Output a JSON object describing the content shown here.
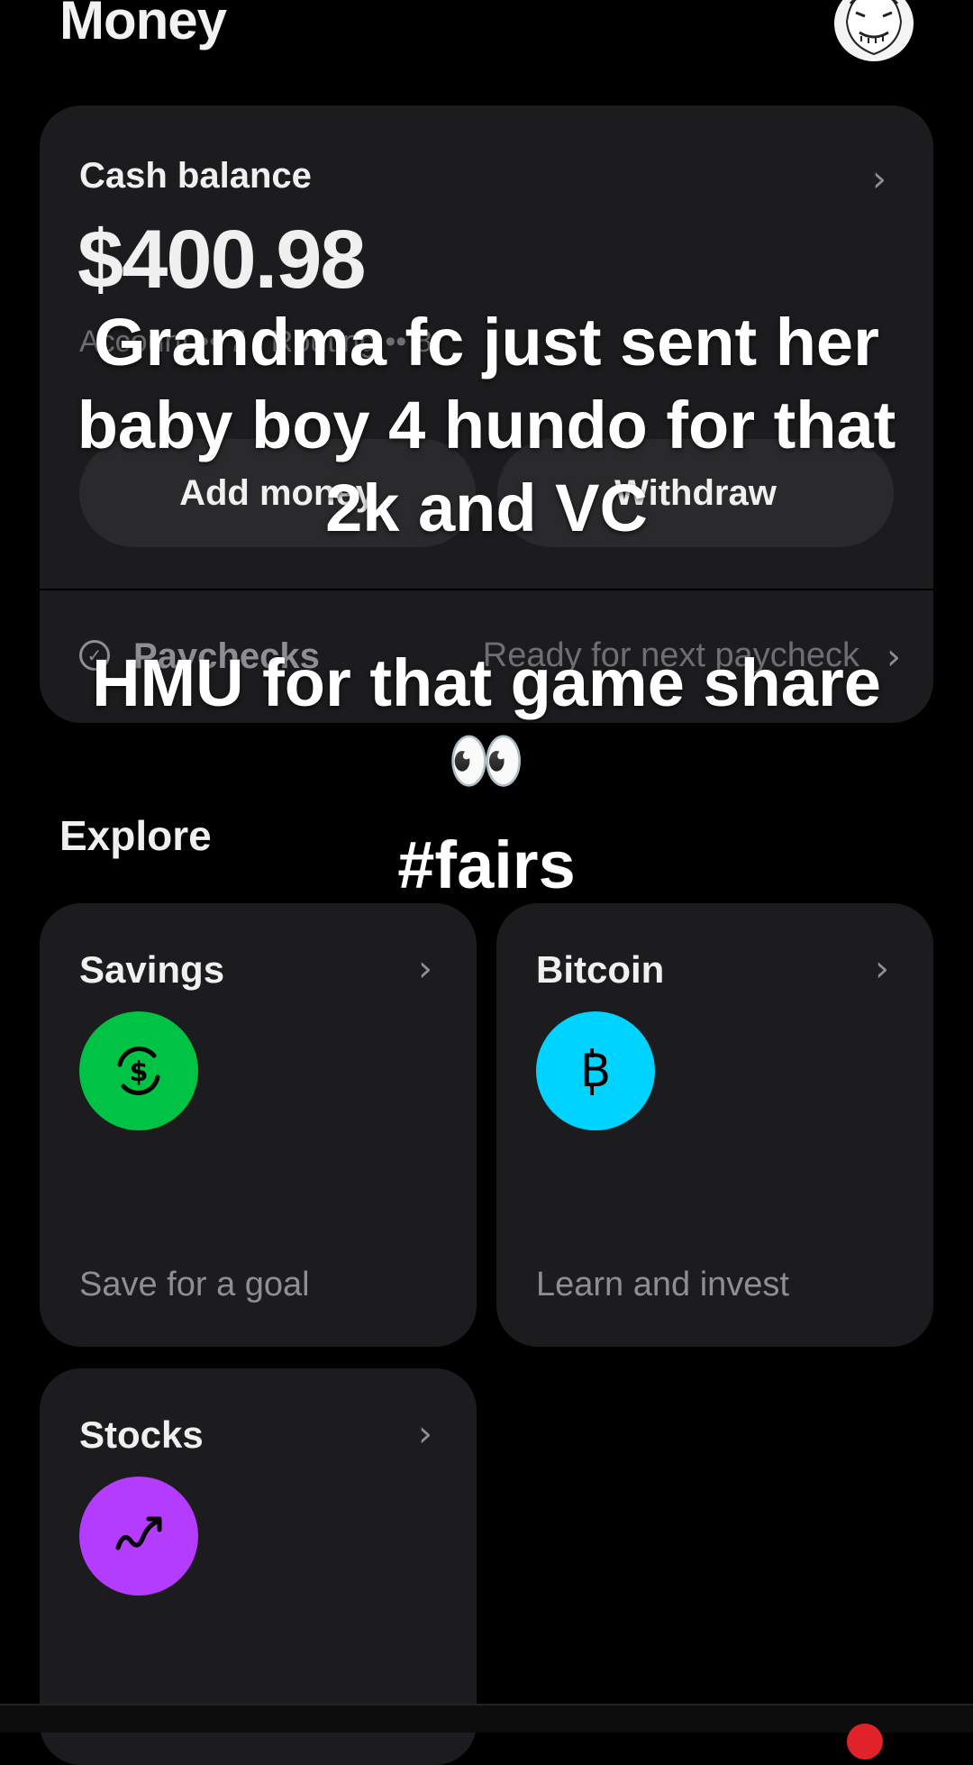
{
  "header": {
    "title": "Money"
  },
  "cash": {
    "label": "Cash balance",
    "balance": "$400.98",
    "routing": "Account •• 7 / Routing •• 8",
    "add_money": "Add money",
    "withdraw": "Withdraw"
  },
  "paychecks": {
    "label": "Paychecks",
    "status": "Ready for next paycheck"
  },
  "explore": {
    "title": "Explore",
    "tiles": [
      {
        "title": "Savings",
        "subtitle": "Save for a goal",
        "icon": "dollar-circle-icon",
        "color": "#00c244"
      },
      {
        "title": "Bitcoin",
        "subtitle": "Learn and invest",
        "icon": "bitcoin-icon",
        "color": "#00d3ff"
      },
      {
        "title": "Stocks",
        "subtitle": "",
        "icon": "stocks-trend-icon",
        "color": "#b43cff"
      }
    ]
  },
  "overlay": {
    "caption1_line1": "Grandma fc just sent her",
    "caption1_line2": "baby boy 4 hundo for that",
    "caption1_line3": "2k and VC",
    "caption2_line1": "HMU for that game share",
    "caption2_eyes": "👀",
    "hashtag": "#fairs"
  }
}
